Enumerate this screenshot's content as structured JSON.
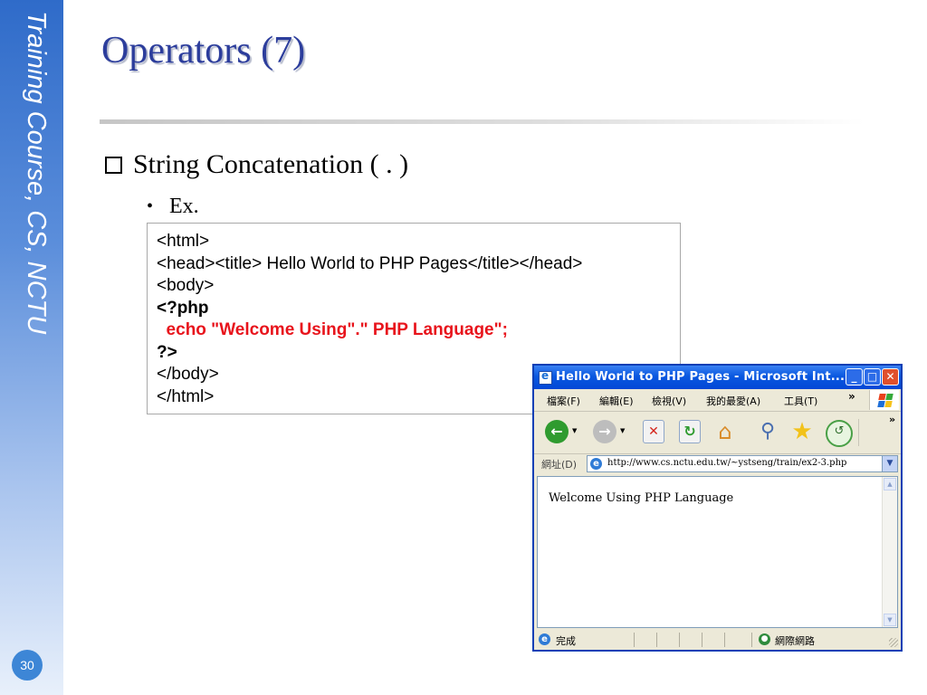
{
  "sidebar": {
    "title": "Training Course, CS, NCTU",
    "page_number": "30"
  },
  "slide": {
    "title": "Operators (7)",
    "bullet": "String Concatenation ( . )",
    "sub_bullet": "Ex.",
    "code_lines": [
      "<html>",
      "<head><title> Hello World to PHP Pages</title></head>",
      "<body>",
      "<?php",
      "  echo \"Welcome Using\".\" PHP Language\";",
      "?>",
      "</body>",
      "</html>"
    ]
  },
  "browser": {
    "title": "Hello World to PHP Pages - Microsoft Int...",
    "menu": [
      "檔案(F)",
      "編輯(E)",
      "檢視(V)",
      "我的最愛(A)",
      "工具(T)"
    ],
    "menu_more": "»",
    "toolbar_more": "»",
    "address_label": "網址(D)",
    "address": "http://www.cs.nctu.edu.tw/~ystseng/train/ex2-3.php",
    "page_text": "Welcome Using PHP Language",
    "status_text": "完成",
    "status_zone": "網際網路"
  },
  "colors": {
    "title": "#2c3d9c",
    "code_red": "#e8141c",
    "sidebar": "#2f6bc9",
    "xp_blue": "#0a58e0"
  },
  "icons": [
    "back-icon",
    "forward-icon",
    "stop-icon",
    "refresh-icon",
    "home-icon",
    "search-icon",
    "favorites-icon",
    "history-icon",
    "ie-icon",
    "internet-zone-icon",
    "windows-logo-icon"
  ]
}
